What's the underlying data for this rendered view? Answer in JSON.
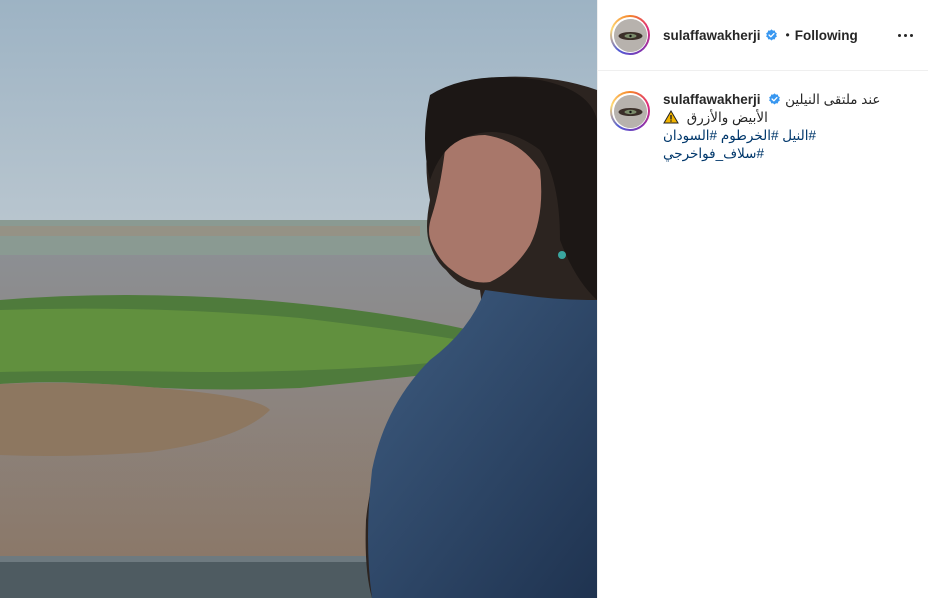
{
  "post": {
    "username": "sulaffawakherji",
    "follow_status": "Following",
    "separator": "•",
    "icons": {
      "verified": "verified-badge-icon",
      "more": "more-options-icon",
      "caption_emoji": "warning-sign-icon"
    },
    "colors": {
      "link": "#00376b",
      "verified": "#3897f0",
      "text": "#262626"
    }
  },
  "caption": {
    "username": "sulaffawakherji",
    "line1": "عند ملتقى النيلين",
    "line2": "الأبيض والأزرق",
    "hashtags_line1": [
      "#النيل",
      "#الخرطوم",
      "#السودان"
    ],
    "hashtags_line2": [
      "#سلاف_فواخرجي"
    ]
  }
}
